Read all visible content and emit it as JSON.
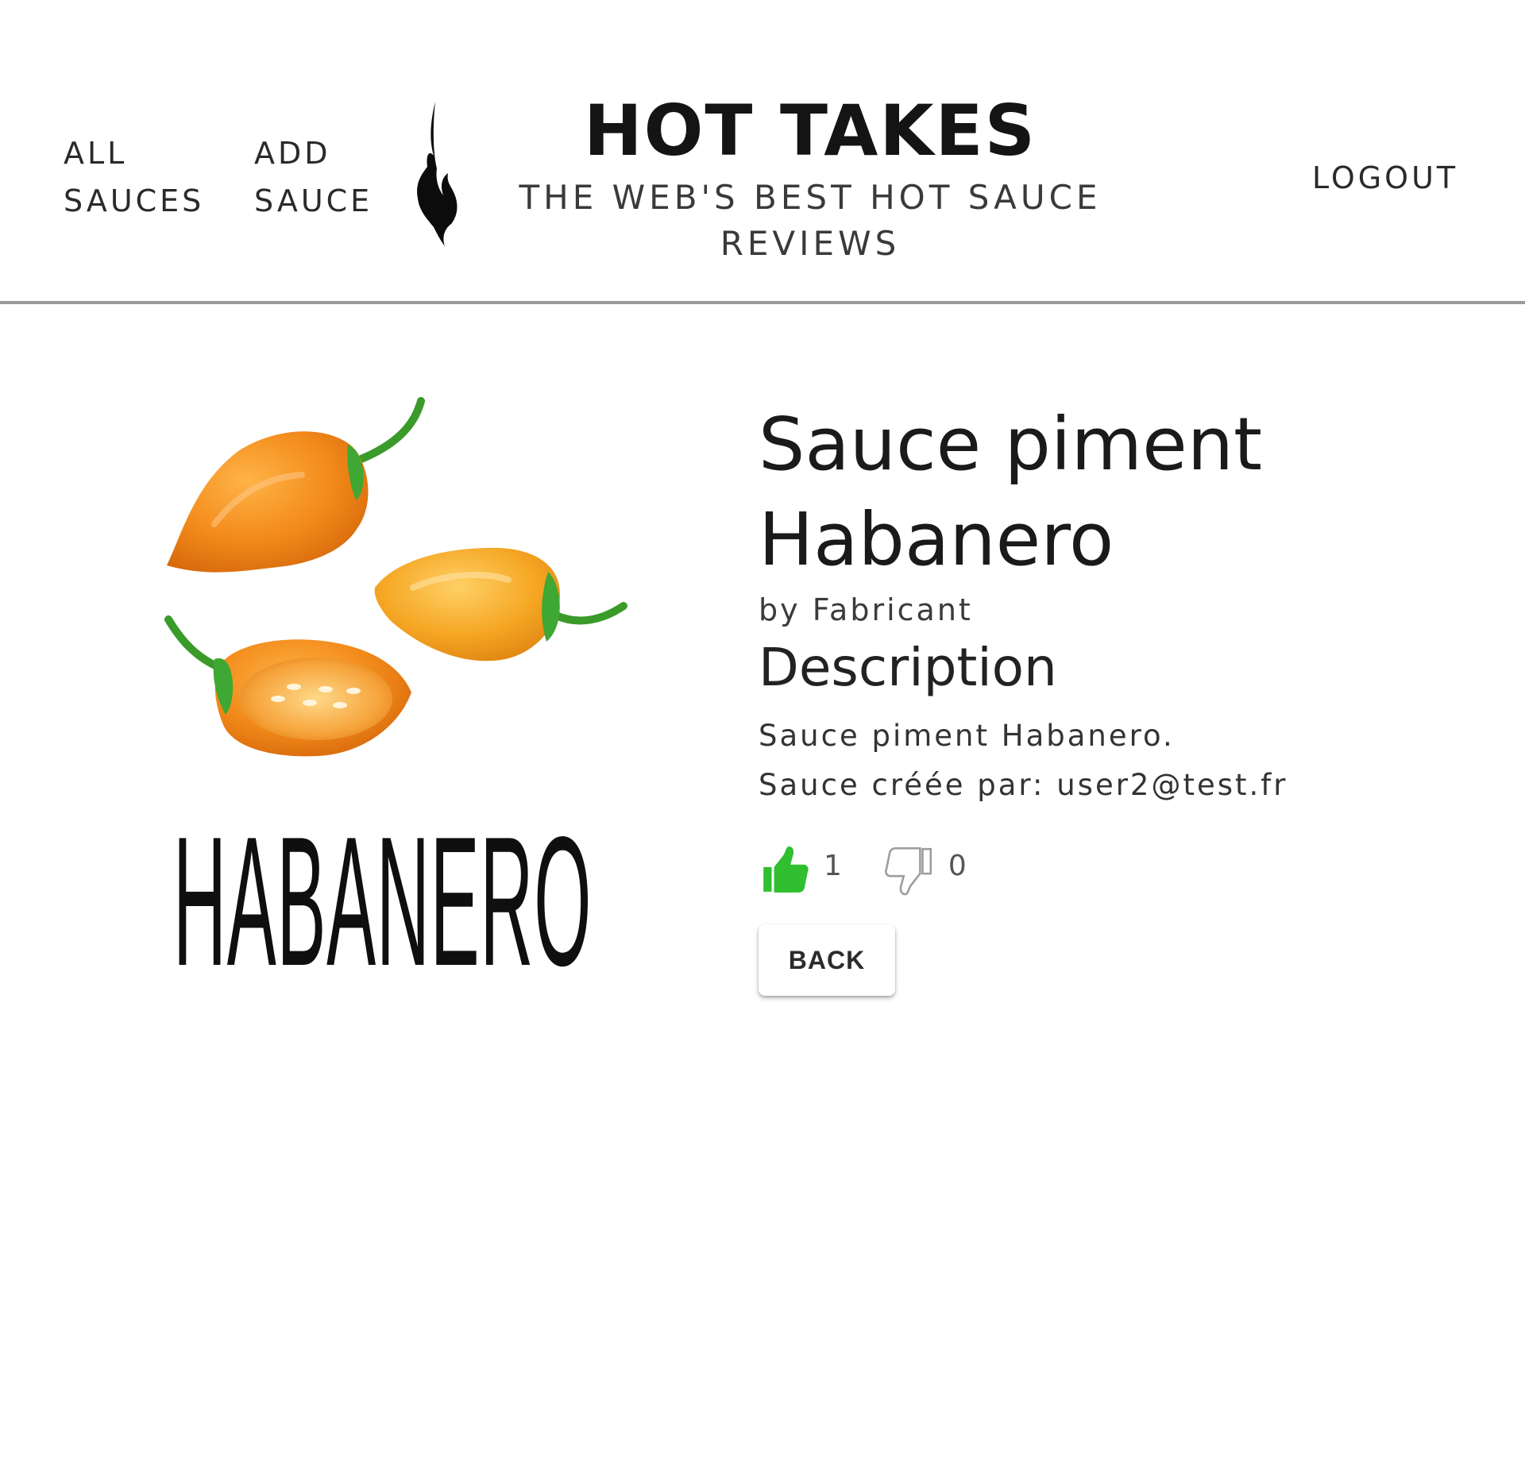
{
  "header": {
    "nav_all_sauces": "ALL\nSAUCES",
    "nav_add_sauce": "ADD\nSAUCE",
    "title": "HOT TAKES",
    "subtitle": "THE WEB'S BEST HOT SAUCE REVIEWS",
    "logout": "LOGOUT",
    "logo_icon": "flame-icon"
  },
  "sauce": {
    "image_label": "HABANERO",
    "image_icon": "habanero-peppers-illustration",
    "name": "Sauce piment Habanero",
    "manufacturer": "by Fabricant",
    "description_heading": "Description",
    "description": "Sauce piment Habanero.\nSauce créée par: user2@test.fr",
    "likes": "1",
    "dislikes": "0",
    "like_icon": "thumbs-up-icon",
    "dislike_icon": "thumbs-down-icon",
    "like_color": "#2fbf2f",
    "back_label": "BACK"
  }
}
